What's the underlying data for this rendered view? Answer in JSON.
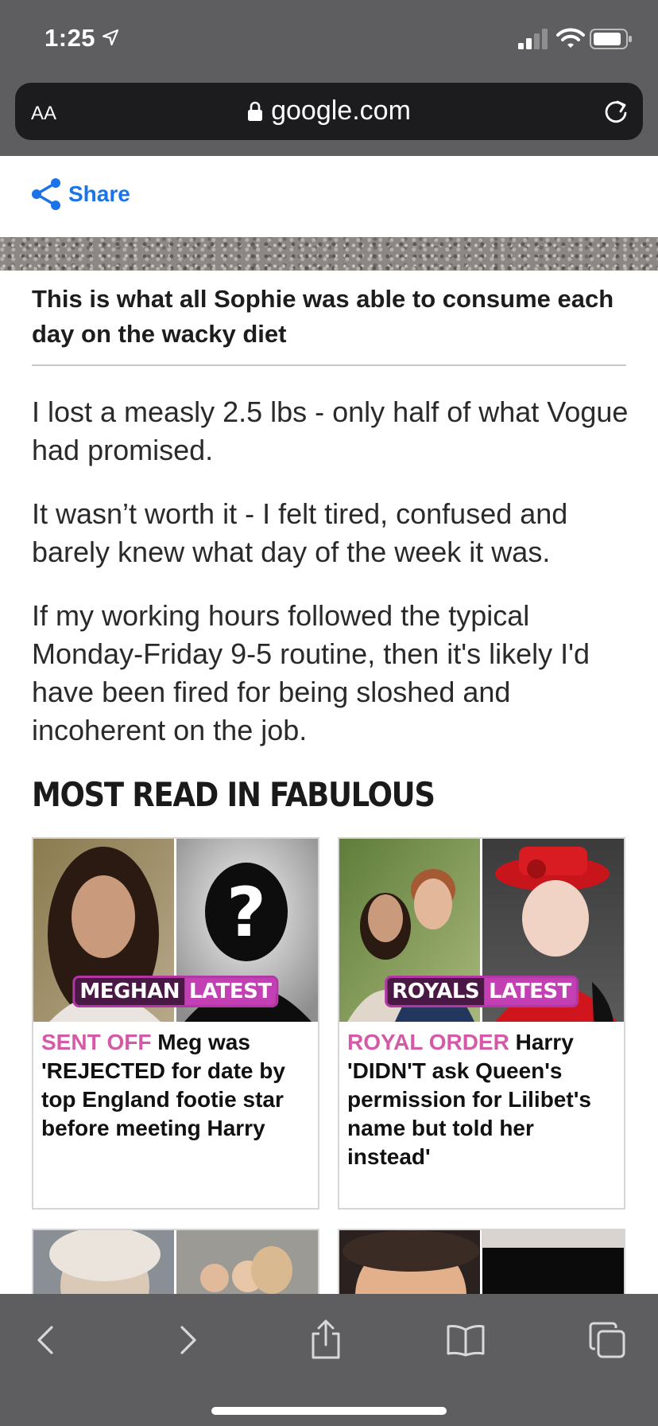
{
  "status_bar": {
    "time": "1:25",
    "location_icon": "location-arrow-icon",
    "signal_icon": "cellular-signal-icon",
    "wifi_icon": "wifi-icon",
    "battery_icon": "battery-icon"
  },
  "browser": {
    "text_size_label": "AA",
    "url": "google.com",
    "lock_icon": "lock-icon",
    "reload_icon": "reload-icon"
  },
  "article": {
    "share_label": "Share",
    "image_caption": "This is what all Sophie was able to consume each day on the wacky diet",
    "paragraphs": [
      "I lost a measly 2.5 lbs - only half of what Vogue had promised.",
      "It wasn’t worth it - I felt tired, confused and barely knew what day of the week it was.",
      "If my working hours followed the typical Monday-Friday 9-5 routine, then it's likely I'd have been fired for being sloshed and incoherent on the job."
    ]
  },
  "most_read": {
    "title": "MOST READ IN FABULOUS",
    "cards": [
      {
        "badge_dark": "MEGHAN",
        "badge_pink": "LATEST",
        "kicker": "SENT OFF",
        "headline": "Meg was 'REJECTED for date by top England footie star before meeting Harry"
      },
      {
        "badge_dark": "ROYALS",
        "badge_pink": "LATEST",
        "kicker": "ROYAL ORDER",
        "headline": "Harry 'DIDN'T ask Queen's permission for Lilibet's name but told her instead'"
      }
    ]
  },
  "toolbar": {
    "back_icon": "back-chevron-icon",
    "forward_icon": "forward-chevron-icon",
    "share_icon": "share-sheet-icon",
    "bookmarks_icon": "bookmarks-book-icon",
    "tabs_icon": "tabs-icon"
  },
  "colors": {
    "chrome": "#5e5e60",
    "url_bar": "#1c1c1e",
    "share_blue": "#1a73e8",
    "kicker_pink": "#d45aa8",
    "badge_pink": "#c23fb4"
  }
}
